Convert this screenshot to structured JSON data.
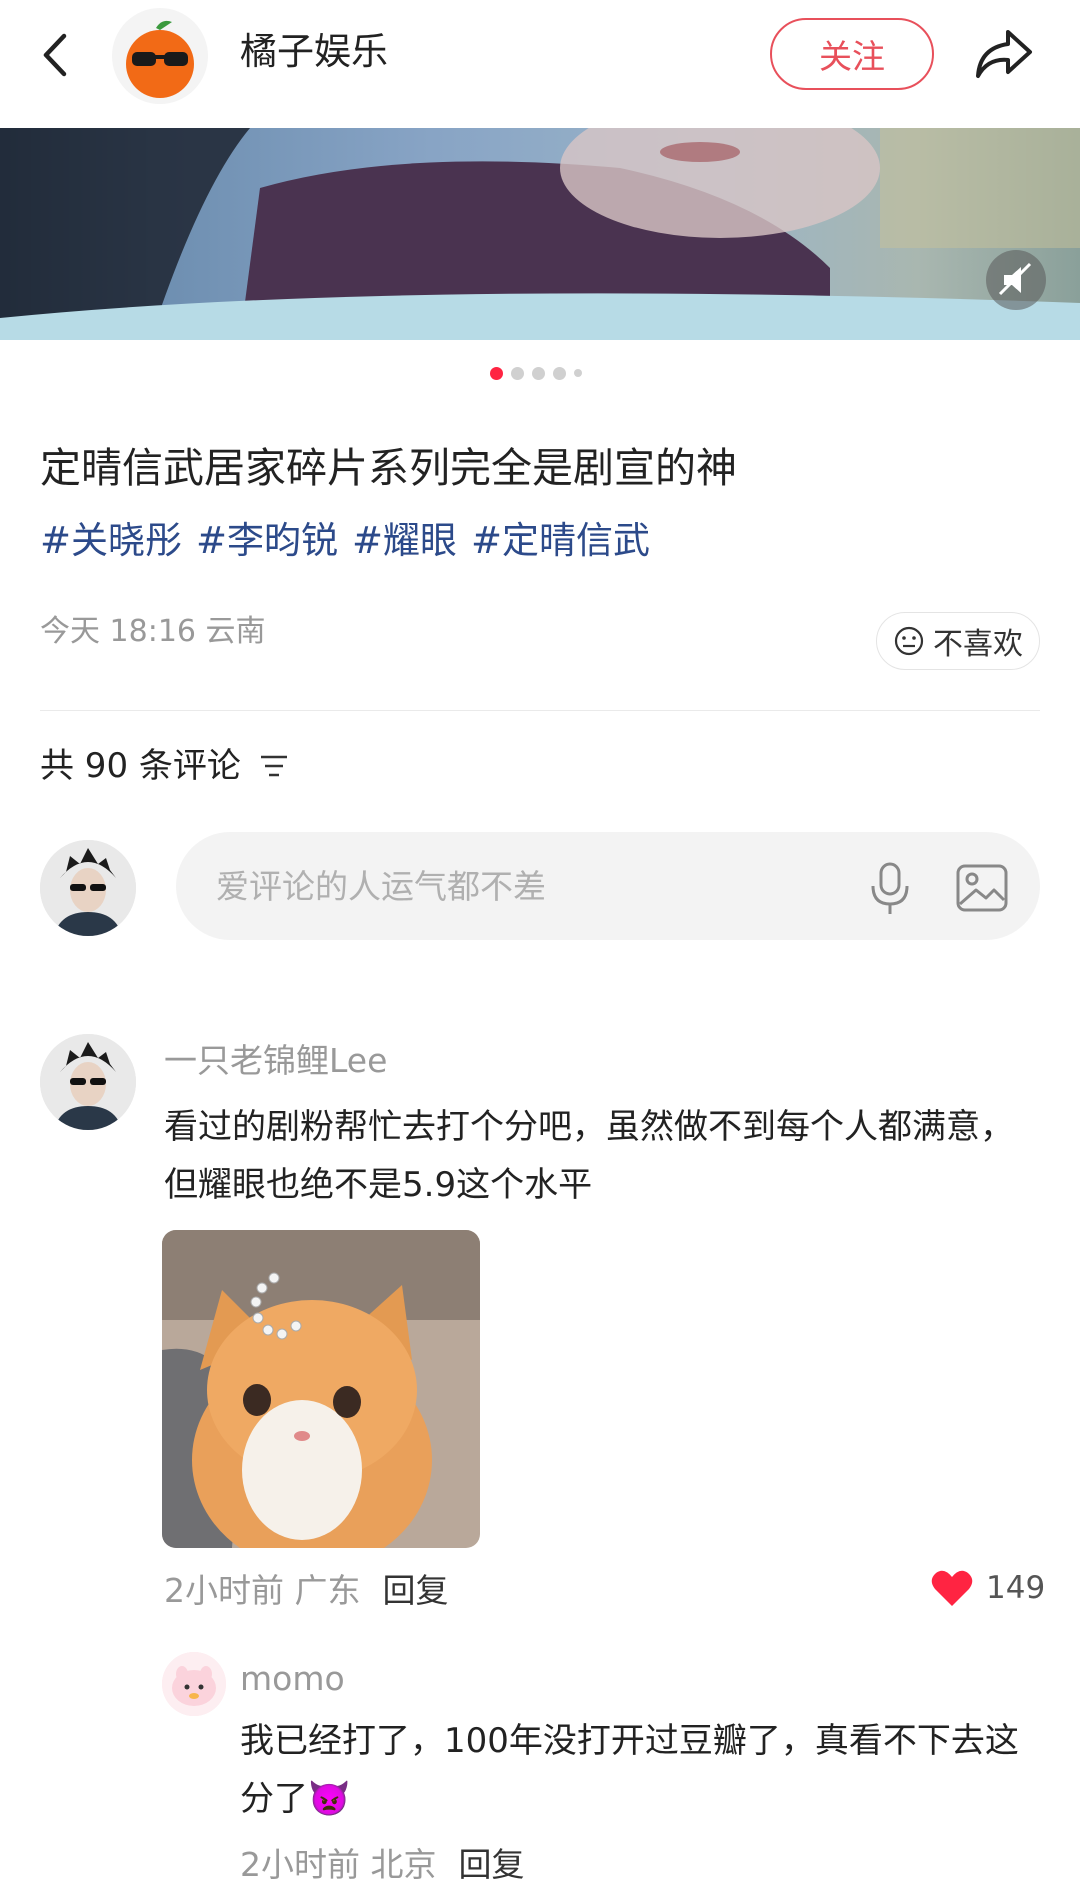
{
  "header": {
    "account_name": "橘子娱乐",
    "follow_label": "关注"
  },
  "media": {
    "slide_count": 5,
    "active_slide": 1
  },
  "post": {
    "title": "定晴信武居家碎片系列完全是剧宣的神",
    "tags": [
      "#关晓彤",
      "#李昀锐",
      "#耀眼",
      "#定晴信武"
    ],
    "meta": "今天 18:16 云南",
    "dislike_label": "不喜欢"
  },
  "comments_header": {
    "count_label": "共 90 条评论"
  },
  "comment_input": {
    "placeholder": "爱评论的人运气都不差"
  },
  "comment": {
    "username": "一只老锦鲤Lee",
    "text": "看过的剧粉帮忙去打个分吧，虽然做不到每个人都满意，但耀眼也绝不是5.9这个水平",
    "time_location": "2小时前 广东",
    "reply_label": "回复",
    "likes": "149"
  },
  "reply": {
    "username": "momo",
    "text": "我已经打了，100年没打开过豆瓣了，真看不下去这分了👿",
    "time_location": "2小时前 北京",
    "reply_label": "回复"
  },
  "colors": {
    "accent": "#ff2442",
    "follow": "#e8505b",
    "tag": "#2c4a8a",
    "muted": "#999999"
  }
}
